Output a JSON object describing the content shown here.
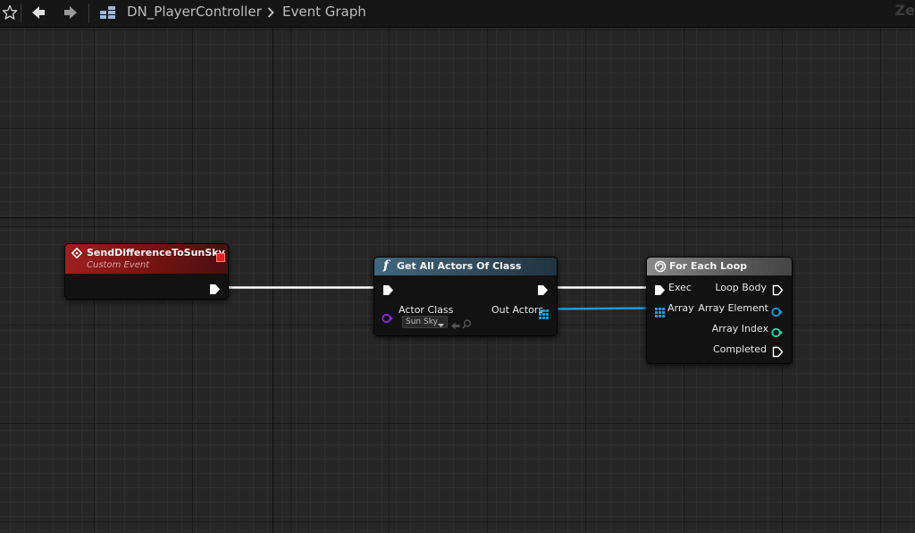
{
  "toolbar": {
    "breadcrumb_blueprint": "DN_PlayerController",
    "breadcrumb_graph": "Event Graph",
    "zoom_text": "Ze"
  },
  "nodes": {
    "custom_event": {
      "title": "SendDifferenceToSunSky",
      "subtitle": "Custom Event"
    },
    "get_all_actors": {
      "title": "Get All Actors Of Class",
      "function_glyph": "f",
      "actor_class_label": "Actor Class",
      "actor_class_value": "Sun Sky",
      "out_actors_label": "Out Actors"
    },
    "for_each_loop": {
      "title": "For Each Loop",
      "exec_label": "Exec",
      "array_label": "Array",
      "loop_body_label": "Loop Body",
      "array_element_label": "Array Element",
      "array_index_label": "Array Index",
      "completed_label": "Completed"
    }
  },
  "colors": {
    "exec_wire": "#ffffff",
    "array_wire": "#1f9ae0",
    "class_pin": "#8a2be2",
    "int_pin": "#1fe0b0",
    "event_header": "#9f1f1f",
    "function_header": "#42677f",
    "macro_header": "#8a8a8a"
  }
}
